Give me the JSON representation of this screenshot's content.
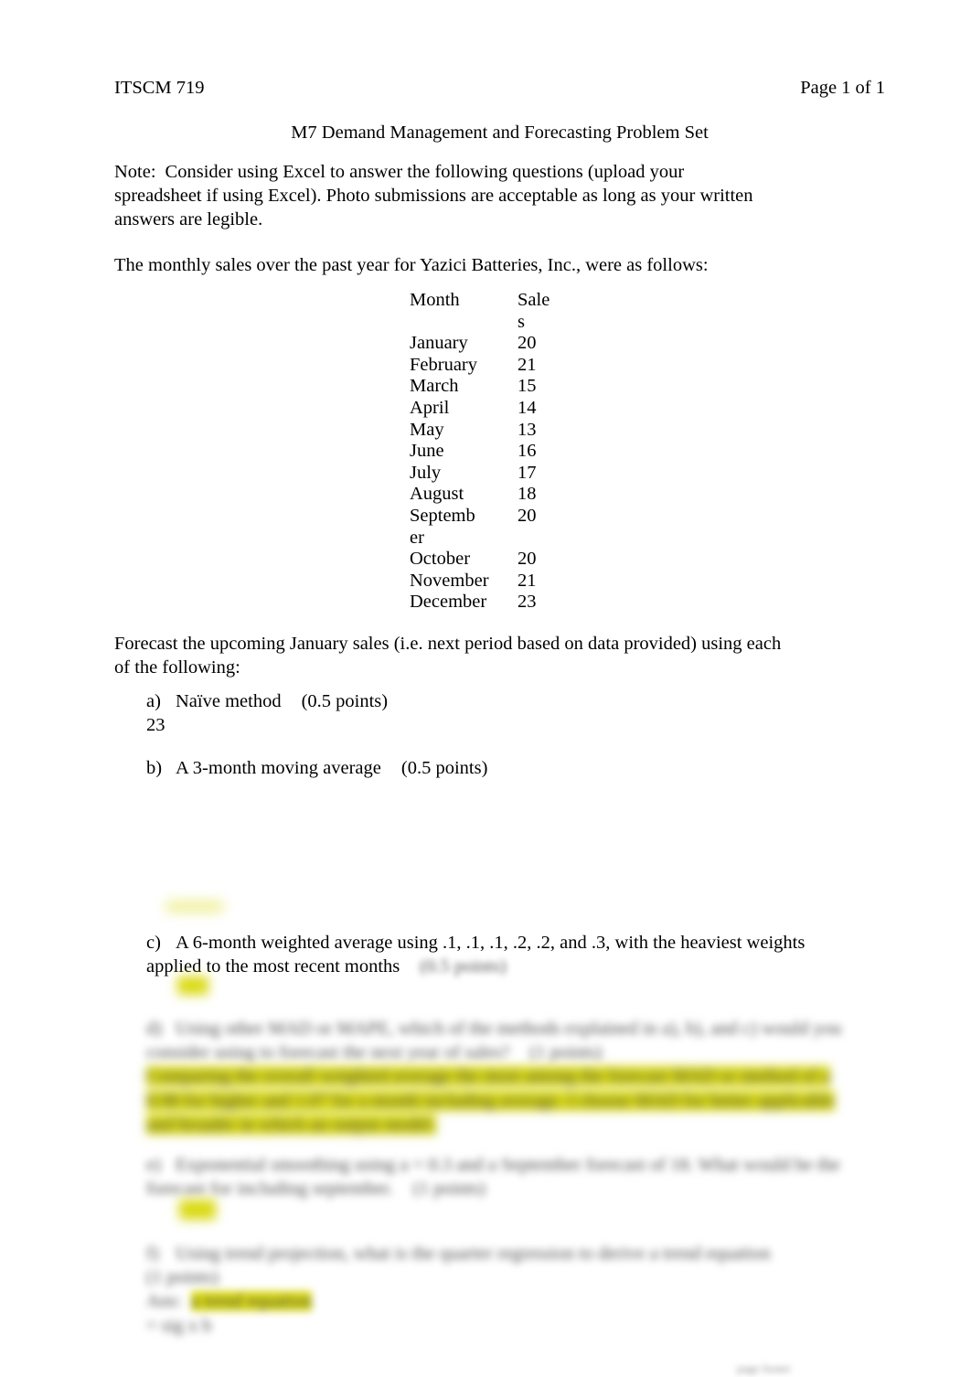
{
  "document": {
    "course_code": "ITSCM 719",
    "page_indicator": "Page 1 of 1",
    "title": "M7 Demand Management and Forecasting Problem Set",
    "note_label": "Note:",
    "note_text": "Consider using Excel to answer the following questions (upload your spreadsheet if using Excel). Photo submissions are acceptable as long as your written answers are legible.",
    "intro_text": "The monthly sales over the past year for Yazici Batteries, Inc., were as follows:",
    "forecast_instruction": "Forecast the upcoming January sales (i.e. next period based on data provided) using each of the following:",
    "footer_mark": "page footer"
  },
  "sales_table": {
    "headers": {
      "month": "Month",
      "sales_line1": "Sale",
      "sales_line2": "s"
    },
    "rows": [
      {
        "month": "January",
        "sales": "20"
      },
      {
        "month": "February",
        "sales": "21"
      },
      {
        "month": "March",
        "sales": "15"
      },
      {
        "month": "April",
        "sales": "14"
      },
      {
        "month": "May",
        "sales": "13"
      },
      {
        "month": "June",
        "sales": "16"
      },
      {
        "month": "July",
        "sales": "17"
      },
      {
        "month": "August",
        "sales": "18"
      },
      {
        "month": "September",
        "sales": "20"
      },
      {
        "month": "October",
        "sales": "20"
      },
      {
        "month": "November",
        "sales": "21"
      },
      {
        "month": "December",
        "sales": "23"
      }
    ]
  },
  "questions": [
    {
      "marker": "a)",
      "text": "Naïve method",
      "points": "(0.5 points)",
      "answer": "23",
      "blurred": false,
      "highlighted_answer": false
    },
    {
      "marker": "b)",
      "text": "A 3-month moving average",
      "points": "(0.5 points)",
      "answer": "",
      "blurred": false,
      "highlighted_answer": false
    },
    {
      "marker": "c)",
      "text": "A 6-month weighted average using .1, .1, .1, .2, .2, and .3, with the heaviest weights applied to the most recent months",
      "points": "(0.5 points)",
      "answer": "",
      "blurred": false,
      "highlighted_answer": true
    },
    {
      "marker": "d)",
      "text": "Using other MAD or MAPE, which of the methods explained in a), b), and c) would you consider using to forecast the next year of sales?",
      "points": "(1 points)",
      "answer": "Comparing the overall weighted average the most among the forecast MAD or method of a 0.98 for higher and 1.07 for a month including average. I choose MAD for better applicable and broader in which an output model.",
      "blurred": true,
      "highlighted_answer": true
    },
    {
      "marker": "e)",
      "text": "Exponential smoothing using a = 0.3 and a September forecast of 18. What would be the forecast for including september.",
      "points": "(1 points)",
      "answer": "",
      "blurred": true,
      "highlighted_answer": true
    },
    {
      "marker": "f)",
      "text": "Using trend projection, what is the quarter regression to derive a trend equation",
      "points": "(1 points)",
      "answer": "",
      "blurred": true,
      "highlighted_answer": true
    }
  ],
  "colors": {
    "highlight": "#dada14",
    "text": "#000000",
    "page_background": "#ffffff"
  }
}
